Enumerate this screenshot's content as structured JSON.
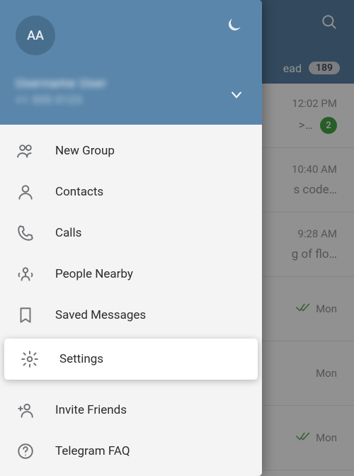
{
  "header": {
    "avatar_initials": "AA",
    "user_name": "Username User",
    "user_phone": "+1 555 0123"
  },
  "menu": {
    "new_group": "New Group",
    "contacts": "Contacts",
    "calls": "Calls",
    "people_nearby": "People Nearby",
    "saved_messages": "Saved Messages",
    "settings": "Settings",
    "invite_friends": "Invite Friends",
    "telegram_faq": "Telegram FAQ"
  },
  "background": {
    "tab_label": "ead",
    "tab_badge": "189",
    "chats": [
      {
        "time": "12:02 PM",
        "snippet": ">…",
        "unread": "2",
        "checks": false
      },
      {
        "time": "10:40 AM",
        "snippet": "s code…",
        "unread": "",
        "checks": false
      },
      {
        "time": "9:28 AM",
        "snippet": "g of flo…",
        "unread": "",
        "checks": false
      },
      {
        "time": "Mon",
        "snippet": "",
        "unread": "",
        "checks": true
      },
      {
        "time": "Mon",
        "snippet": "",
        "unread": "",
        "checks": false
      },
      {
        "time": "Mon",
        "snippet": "",
        "unread": "",
        "checks": true
      }
    ]
  }
}
